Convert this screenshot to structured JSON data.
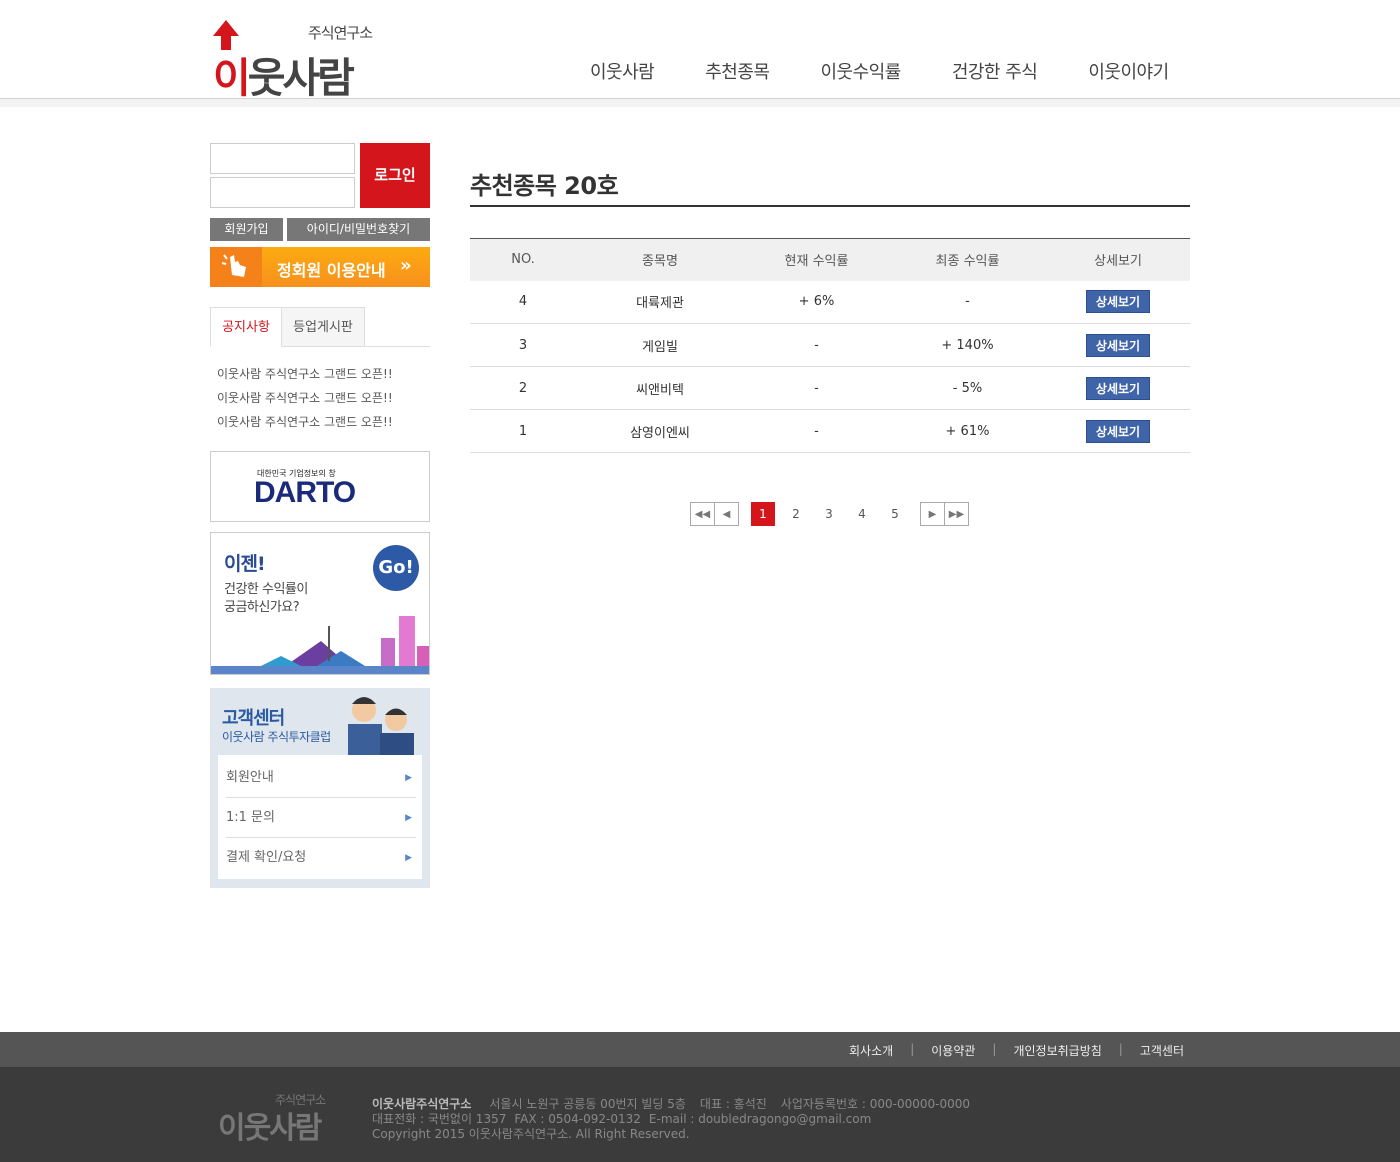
{
  "header": {
    "logo_sub": "주식연구소",
    "logo_main_red": "이",
    "logo_main": "웃사람",
    "nav": [
      "이웃사람",
      "추천종목",
      "이웃수익률",
      "건강한 주식",
      "이웃이야기"
    ]
  },
  "sidebar": {
    "login_button": "로그인",
    "join_button": "회원가입",
    "find_button": "아이디/비밀번호찾기",
    "member_guide": "정회원 이용안내",
    "member_guide_chevron": "»",
    "tabs": [
      "공지사항",
      "등업게시판"
    ],
    "notices": [
      "이웃사람 주식연구소 그랜드 오픈!!",
      "이웃사람 주식연구소 그랜드 오픈!!",
      "이웃사람 주식연구소 그랜드 오픈!!"
    ],
    "dart_banner": {
      "small": "대한민국 기업정보의 창",
      "logo": "DARTO"
    },
    "ijen_banner": {
      "title": "이젠!",
      "line1": "건강한 수익률이",
      "line2": "궁금하신가요?",
      "go": "Go!"
    },
    "customer_center": {
      "title": "고객센터",
      "subtitle": "이웃사람 주식투자클럽",
      "items": [
        "회원안내",
        "1:1 문의",
        "결제 확인/요청"
      ]
    }
  },
  "main": {
    "title": "추천종목 20호",
    "table": {
      "headers": [
        "NO.",
        "종목명",
        "현재 수익률",
        "최종 수익률",
        "상세보기"
      ],
      "rows": [
        {
          "no": "4",
          "name": "대륙제관",
          "current": "+ 6%",
          "final": "-",
          "button": "상세보기"
        },
        {
          "no": "3",
          "name": "게임빌",
          "current": "-",
          "final": "+ 140%",
          "button": "상세보기"
        },
        {
          "no": "2",
          "name": "씨앤비텍",
          "current": "-",
          "final": "- 5%",
          "button": "상세보기"
        },
        {
          "no": "1",
          "name": "삼영이엔씨",
          "current": "-",
          "final": "+ 61%",
          "button": "상세보기"
        }
      ]
    },
    "pagination": {
      "pages": [
        "1",
        "2",
        "3",
        "4",
        "5"
      ],
      "current": "1"
    }
  },
  "footer": {
    "links": [
      "회사소개",
      "이용약관",
      "개인정보취급방침",
      "고객센터"
    ],
    "separator": "|",
    "logo_sub": "주식연구소",
    "logo_main": "이웃사람",
    "company": "이웃사람주식연구소",
    "address": "서울시 노원구 공릉동 00번지 빌딩 5층",
    "ceo": "대표 : 홍석진",
    "biz_no": "사업자등록번호 : 000-00000-0000",
    "phone": "대표전화 : 국번없이 1357",
    "fax": "FAX : 0504-092-0132",
    "email": "E-mail : doubledragongo@gmail.com",
    "copyright": "Copyright 2015 이웃사람주식연구소. All Right Reserved."
  },
  "colors": {
    "brand_red": "#d4161c",
    "button_blue": "#3f64a8",
    "guide_orange": "#f7901e"
  }
}
